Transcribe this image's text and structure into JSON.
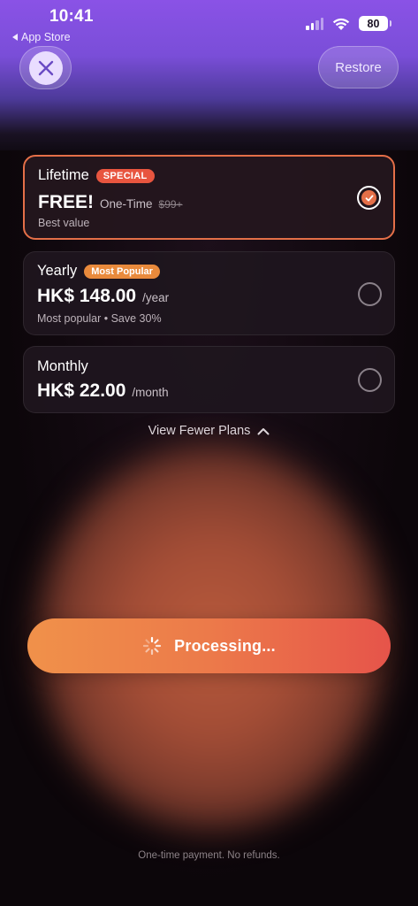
{
  "status_bar": {
    "time": "10:41",
    "back_label": "App Store",
    "battery": "80"
  },
  "header": {
    "close_icon": "close-x-icon",
    "restore_label": "Restore"
  },
  "plans": [
    {
      "name": "Lifetime",
      "badge": "SPECIAL",
      "price": "FREE!",
      "suffix": "One-Time",
      "original_price": "$99+",
      "subtitle": "Best value",
      "selected": true
    },
    {
      "name": "Yearly",
      "badge": "Most Popular",
      "price": "HK$ 148.00",
      "suffix": "/year",
      "subtitle": "Most popular • Save 30%",
      "selected": false
    },
    {
      "name": "Monthly",
      "price": "HK$ 22.00",
      "suffix": "/month",
      "selected": false
    }
  ],
  "toggle_plans_label": "View Fewer Plans",
  "cta": {
    "label": "Processing...",
    "icon": "spinner-icon"
  },
  "footer_text": "One-time payment. No refunds.",
  "colors": {
    "accent": "#e46f48",
    "header_purple": "#8a52e6",
    "cta_start": "#f0914a",
    "cta_end": "#e6544a"
  }
}
